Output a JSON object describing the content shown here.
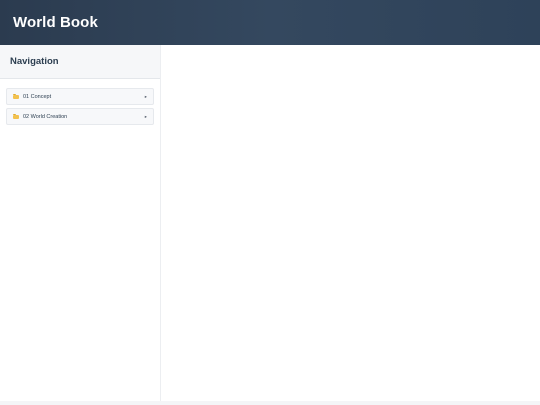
{
  "header": {
    "title": "World Book"
  },
  "sidebar": {
    "title": "Navigation",
    "items": [
      {
        "icon": "folder-icon",
        "label": "01 Concept",
        "arrow": "▸"
      },
      {
        "icon": "folder-icon",
        "label": "02 World Creation",
        "arrow": "▸"
      }
    ]
  },
  "colors": {
    "header_bg": "#2e4259",
    "header_text": "#ffffff",
    "folder": "#f2c14e"
  }
}
